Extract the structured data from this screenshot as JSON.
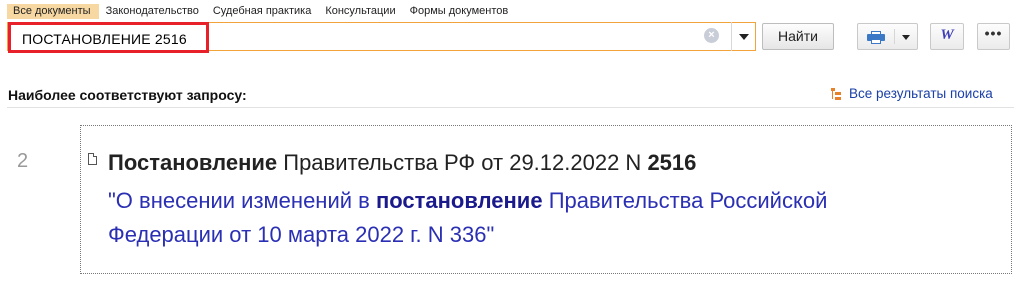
{
  "tabs": [
    {
      "label": "Все документы",
      "active": true
    },
    {
      "label": "Законодательство",
      "active": false
    },
    {
      "label": "Судебная практика",
      "active": false
    },
    {
      "label": "Консультации",
      "active": false
    },
    {
      "label": "Формы документов",
      "active": false
    }
  ],
  "search": {
    "value": "ПОСТАНОВЛЕНИЕ 2516",
    "find_label": "Найти"
  },
  "toolbar": {
    "print_icon": "printer-icon",
    "word_label": "W",
    "more_label": "•••"
  },
  "section": {
    "title": "Наиболее соответствуют запросу:",
    "all_results_label": "Все результаты поиска"
  },
  "result": {
    "number": "2",
    "title_bold": "Постановление",
    "title_mid": " Правительства РФ от 29.12.2022 N ",
    "title_num": "2516",
    "desc_pre": "\"О внесении изменений в ",
    "desc_bold": "постановление",
    "desc_post": " Правительства Российской Федерации от 10 марта 2022 г. N 336\""
  },
  "colors": {
    "active_tab_bg": "#f7d8a2",
    "search_border": "#f2a33a",
    "highlight_border": "#e8202a",
    "link": "#1a3fa8",
    "result_desc": "#2a2fb3"
  }
}
